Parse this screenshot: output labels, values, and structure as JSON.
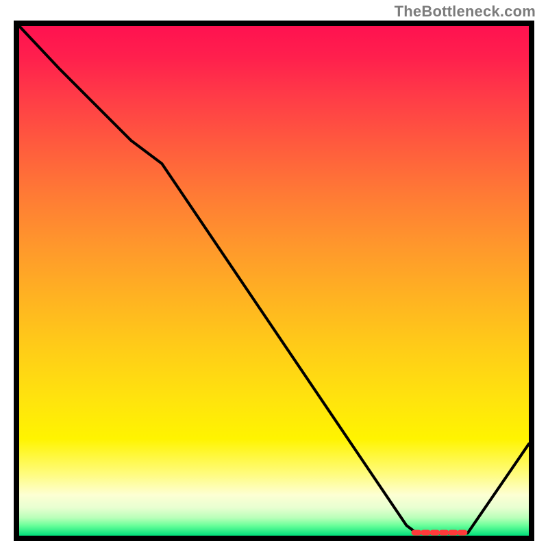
{
  "attribution": "TheBottleneck.com",
  "chart_data": {
    "type": "line",
    "title": "",
    "xlabel": "",
    "ylabel": "",
    "xlim": [
      0,
      100
    ],
    "ylim": [
      0,
      100
    ],
    "series": [
      {
        "name": "bottleneck-curve",
        "x": [
          0,
          8,
          22,
          28,
          76,
          78,
          88,
          100
        ],
        "values": [
          100,
          91.5,
          77.5,
          73,
          2,
          0.5,
          0.5,
          18
        ]
      }
    ],
    "gradient_stops": [
      {
        "pct": 0,
        "color": "#ff1250"
      },
      {
        "pct": 6,
        "color": "#ff1f4d"
      },
      {
        "pct": 14,
        "color": "#ff3c47"
      },
      {
        "pct": 23,
        "color": "#ff5a3e"
      },
      {
        "pct": 33,
        "color": "#ff7a35"
      },
      {
        "pct": 43,
        "color": "#ff972c"
      },
      {
        "pct": 53,
        "color": "#ffb222"
      },
      {
        "pct": 63,
        "color": "#ffcc18"
      },
      {
        "pct": 73,
        "color": "#ffe30e"
      },
      {
        "pct": 81,
        "color": "#fff400"
      },
      {
        "pct": 88,
        "color": "#fffc80"
      },
      {
        "pct": 92,
        "color": "#fdffd3"
      },
      {
        "pct": 94.5,
        "color": "#e8ffd1"
      },
      {
        "pct": 96.5,
        "color": "#b9ffb9"
      },
      {
        "pct": 98,
        "color": "#6aff9a"
      },
      {
        "pct": 100,
        "color": "#00e07a"
      }
    ],
    "optimal_marker": {
      "x_start": 77.5,
      "x_end": 88,
      "y": 0.6,
      "color": "#ff3a3a"
    }
  }
}
